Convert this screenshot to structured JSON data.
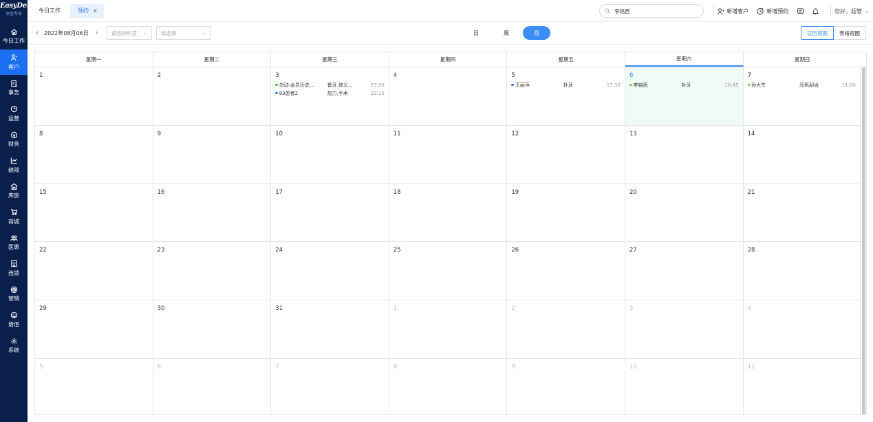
{
  "sidebar": {
    "logo": "EasyDent",
    "logo_sub": "牙医专业",
    "items": [
      {
        "label": "今日工作",
        "icon": "home-icon"
      },
      {
        "label": "客户",
        "icon": "user-icon"
      },
      {
        "label": "事务",
        "icon": "task-icon"
      },
      {
        "label": "运营",
        "icon": "clock-icon"
      },
      {
        "label": "财务",
        "icon": "money-icon"
      },
      {
        "label": "绩效",
        "icon": "chart-icon"
      },
      {
        "label": "库房",
        "icon": "warehouse-icon"
      },
      {
        "label": "商城",
        "icon": "cart-icon"
      },
      {
        "label": "医患",
        "icon": "people-icon"
      },
      {
        "label": "连锁",
        "icon": "building-icon"
      },
      {
        "label": "营销",
        "icon": "marketing-icon"
      },
      {
        "label": "增值",
        "icon": "value-icon"
      },
      {
        "label": "系统",
        "icon": "settings-icon"
      }
    ]
  },
  "tabs": [
    {
      "label": "今日工作"
    },
    {
      "label": "预约",
      "close": "×"
    }
  ],
  "header": {
    "search_value": "李铭西",
    "new_customer": "新增客户",
    "new_appointment": "新增预约",
    "greeting": "您好，超管"
  },
  "toolbar": {
    "prev": "‹",
    "next": "›",
    "date": "2022年08月06日",
    "dept_placeholder": "请选择科室",
    "other_placeholder": "请选择",
    "views": {
      "day": "日",
      "week": "周",
      "month": "月"
    },
    "calendar_view": "日历视图",
    "table_view": "表格视图"
  },
  "calendar": {
    "weekdays": [
      "星期一",
      "星期二",
      "星期三",
      "星期四",
      "星期五",
      "星期六",
      "星期日"
    ],
    "weeks": [
      [
        {
          "day": "1"
        },
        {
          "day": "2"
        },
        {
          "day": "3",
          "events": [
            {
              "name": "勿动:会员历史...",
              "item": "备牙,修义...",
              "time": "23:30",
              "color": "#52c41a"
            },
            {
              "name": "83患者2",
              "item": "加力,手术",
              "time": "23:15",
              "color": "#2f7df6"
            }
          ]
        },
        {
          "day": "4"
        },
        {
          "day": "5",
          "events": [
            {
              "name": "王丽萍",
              "item": "补牙",
              "time": "17:30",
              "color": "#2f7df6"
            }
          ]
        },
        {
          "day": "6",
          "today": true,
          "events": [
            {
              "name": "李铭西",
              "item": "补牙",
              "time": "16:45",
              "color": "#52c41a"
            }
          ]
        },
        {
          "day": "7",
          "events": [
            {
              "name": "孙大生",
              "item": "压氧刮治",
              "time": "11:00",
              "color": "#52c41a"
            }
          ]
        }
      ],
      [
        {
          "day": "8"
        },
        {
          "day": "9"
        },
        {
          "day": "10"
        },
        {
          "day": "11"
        },
        {
          "day": "12"
        },
        {
          "day": "13"
        },
        {
          "day": "14"
        }
      ],
      [
        {
          "day": "15"
        },
        {
          "day": "16"
        },
        {
          "day": "17"
        },
        {
          "day": "18"
        },
        {
          "day": "19"
        },
        {
          "day": "20"
        },
        {
          "day": "21"
        }
      ],
      [
        {
          "day": "22"
        },
        {
          "day": "23"
        },
        {
          "day": "24"
        },
        {
          "day": "25"
        },
        {
          "day": "26"
        },
        {
          "day": "27"
        },
        {
          "day": "28"
        }
      ],
      [
        {
          "day": "29"
        },
        {
          "day": "30"
        },
        {
          "day": "31"
        },
        {
          "day": "1",
          "other": true
        },
        {
          "day": "2",
          "other": true
        },
        {
          "day": "3",
          "other": true
        },
        {
          "day": "4",
          "other": true
        }
      ],
      [
        {
          "day": "5",
          "other": true
        },
        {
          "day": "6",
          "other": true
        },
        {
          "day": "7",
          "other": true
        },
        {
          "day": "8",
          "other": true
        },
        {
          "day": "9",
          "other": true
        },
        {
          "day": "10",
          "other": true
        },
        {
          "day": "11",
          "other": true
        }
      ]
    ]
  }
}
